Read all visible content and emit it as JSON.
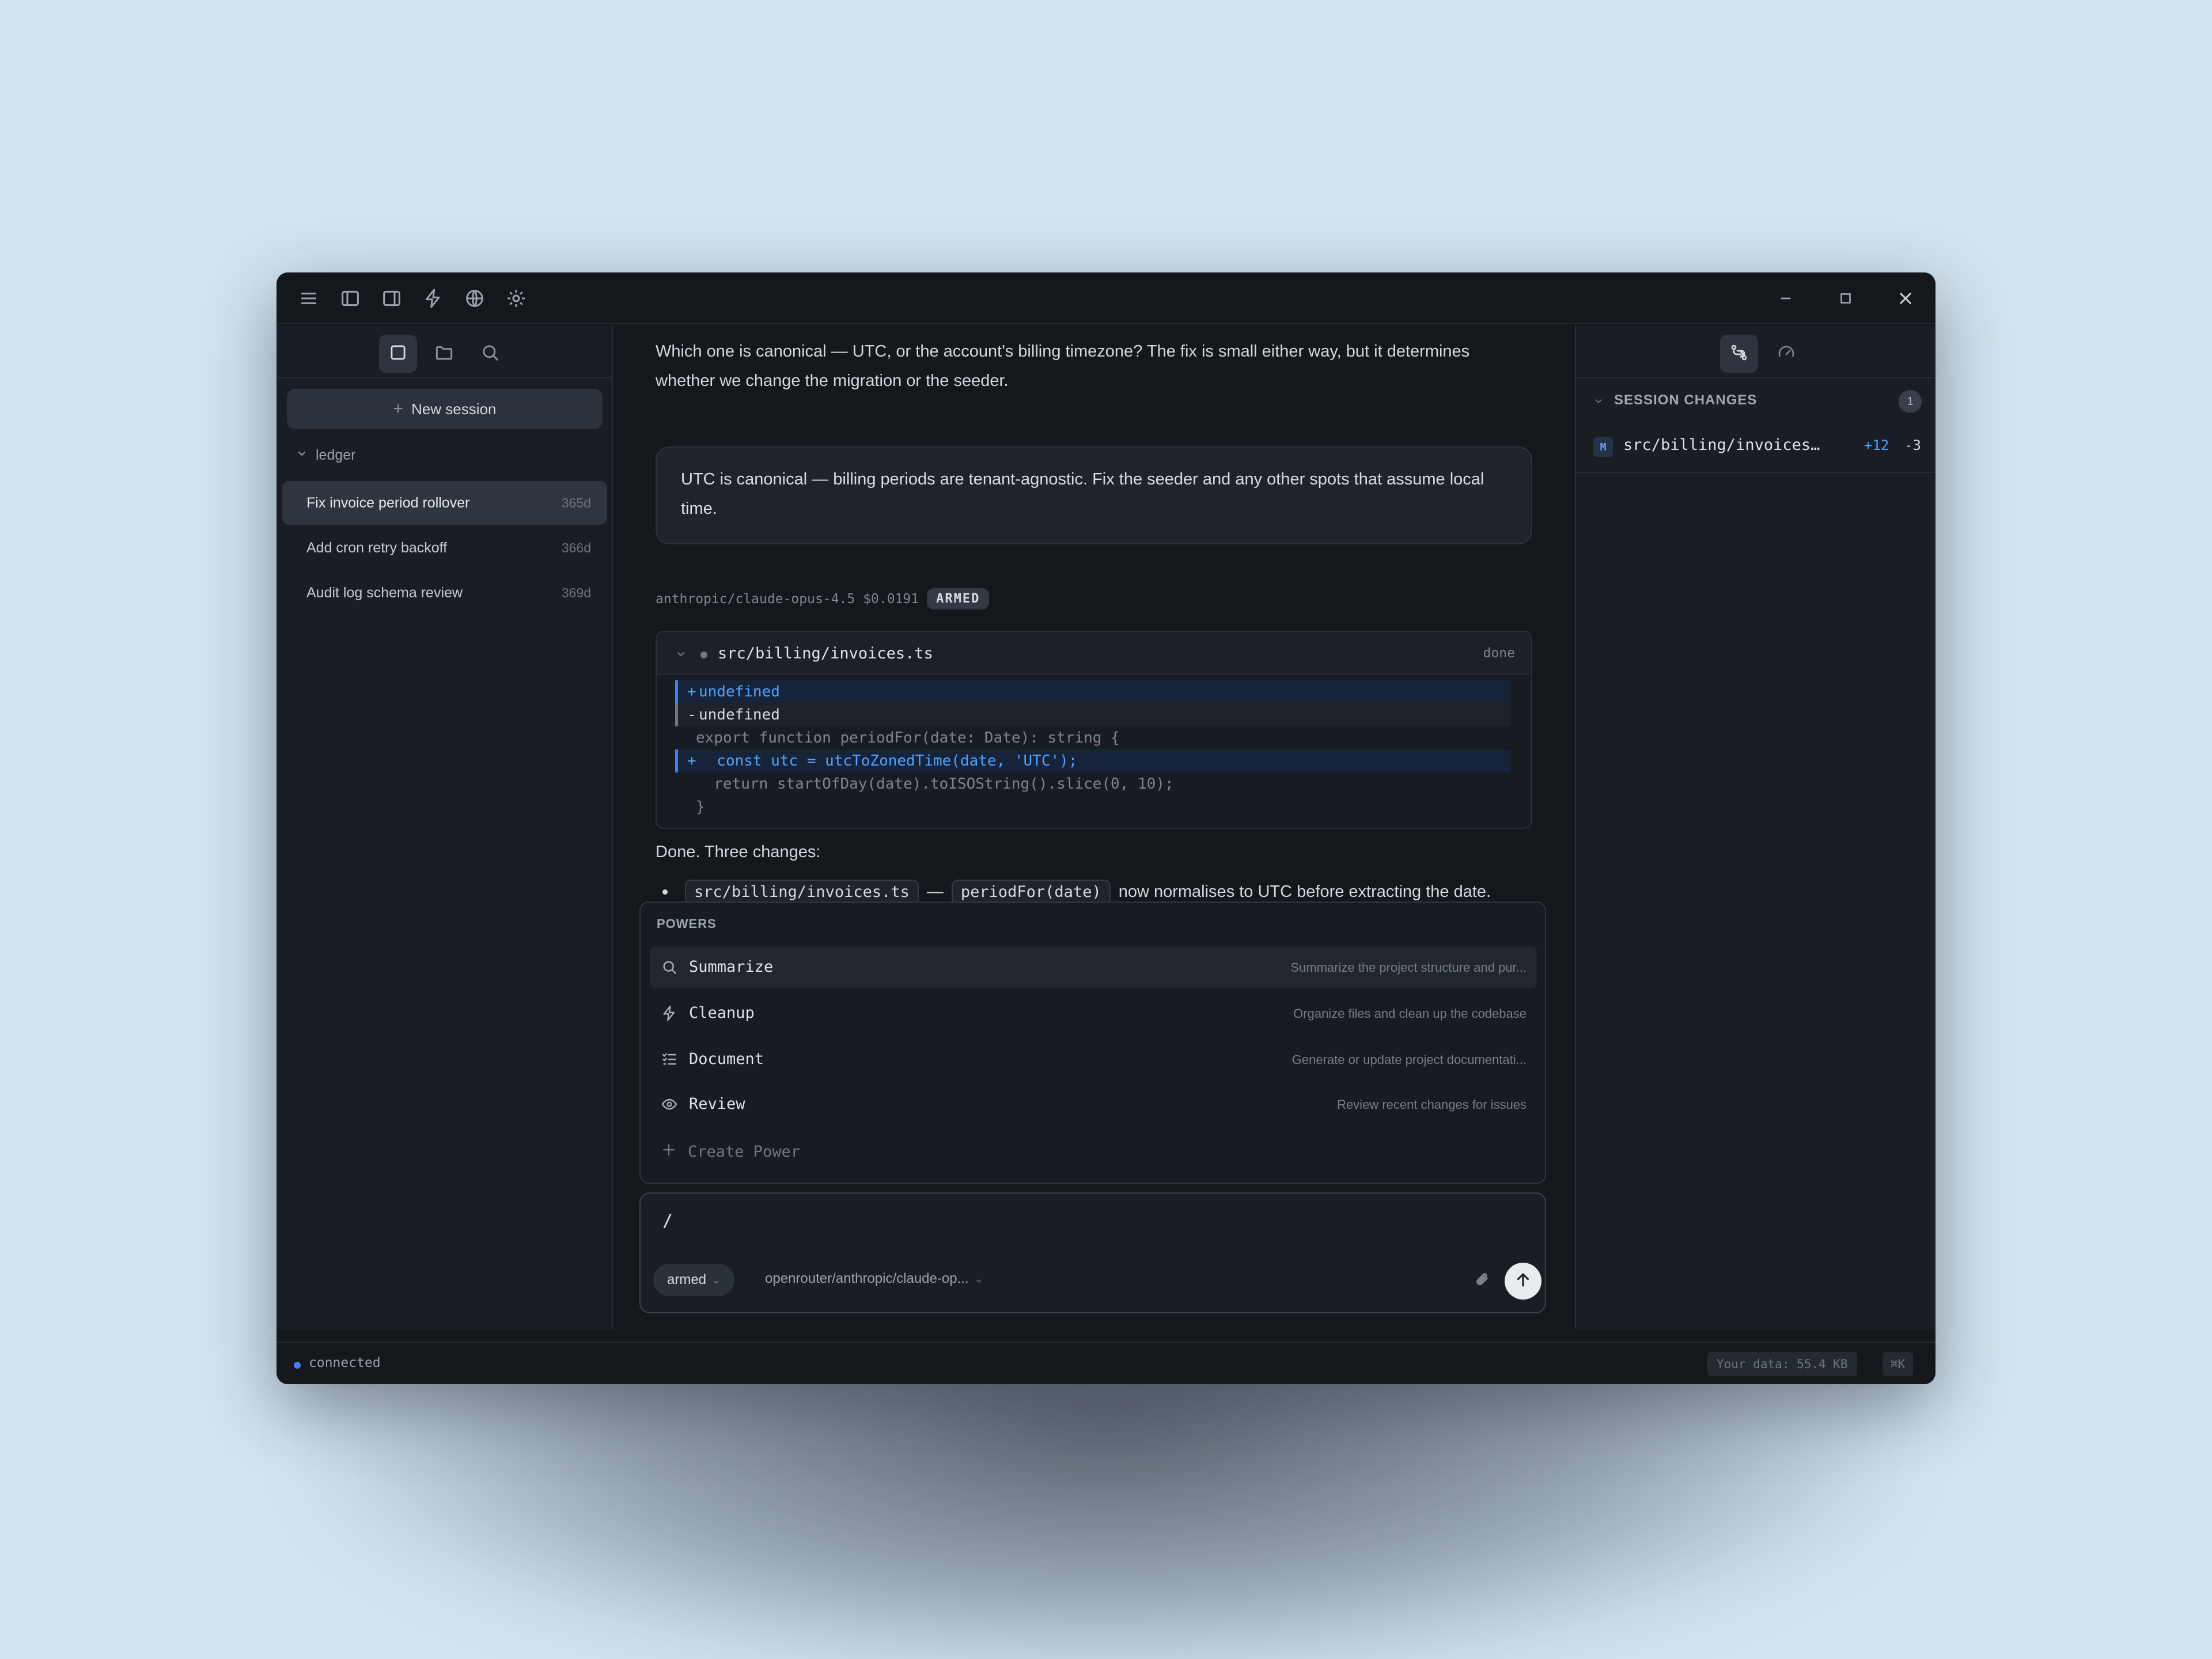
{
  "sidebar": {
    "new_session_label": "New session",
    "group": "ledger",
    "sessions": [
      {
        "title": "Fix invoice period rollover",
        "age": "365d"
      },
      {
        "title": "Add cron retry backoff",
        "age": "366d"
      },
      {
        "title": "Audit log schema review",
        "age": "369d"
      }
    ]
  },
  "chat": {
    "assistant_question": "Which one is canonical — UTC, or the account's billing timezone? The fix is small either way, but it determines whether we change the migration or the seeder.",
    "user_reply": "UTC is canonical — billing periods are tenant-agnostic. Fix the seeder and any other spots that assume local time.",
    "model_name": "anthropic/claude-opus-4.5",
    "cost": "$0.0191",
    "mode_badge": "ARMED",
    "diff": {
      "file": "src/billing/invoices.ts",
      "status": "done",
      "lines": [
        {
          "kind": "add",
          "sign": "+",
          "text": "undefined"
        },
        {
          "kind": "del",
          "sign": "-",
          "text": "undefined"
        },
        {
          "kind": "ctx",
          "sign": "",
          "text": "export function periodFor(date: Date): string {"
        },
        {
          "kind": "add",
          "sign": "+",
          "text": "  const utc = utcToZonedTime(date, 'UTC');"
        },
        {
          "kind": "ctx",
          "sign": "",
          "text": "  return startOfDay(date).toISOString().slice(0, 10);"
        },
        {
          "kind": "ctx",
          "sign": "",
          "text": "}"
        }
      ]
    },
    "done_text": "Done. Three changes:",
    "bullet": {
      "file_code": "src/billing/invoices.ts",
      "dash": "—",
      "fn_code": "periodFor(date)",
      "rest": "now normalises to UTC before extracting the date."
    }
  },
  "powers": {
    "title": "POWERS",
    "items": [
      {
        "name": "Summarize",
        "desc": "Summarize the project structure and pur...",
        "icon": "search-icon"
      },
      {
        "name": "Cleanup",
        "desc": "Organize files and clean up the codebase",
        "icon": "lightning-icon"
      },
      {
        "name": "Document",
        "desc": "Generate or update project documentati...",
        "icon": "list-check-icon"
      },
      {
        "name": "Review",
        "desc": "Review recent changes for issues",
        "icon": "eye-icon"
      }
    ],
    "create_label": "Create Power"
  },
  "composer": {
    "value": "/",
    "mode": "armed",
    "model": "openrouter/anthropic/claude-op..."
  },
  "right_panel": {
    "section_title": "SESSION CHANGES",
    "count": "1",
    "file": {
      "badge": "M",
      "path": "src/billing/invoices…",
      "adds": "+12",
      "dels": "-3"
    }
  },
  "status_bar": {
    "connection": "connected",
    "data_usage": "Your data: 55.4 KB",
    "shortcut": "⌘K"
  },
  "colors": {
    "accent": "#3b82f6",
    "window_bg": "#14171c",
    "panel_bg": "#1a1e24",
    "page_bg": "#d2e2f0"
  }
}
